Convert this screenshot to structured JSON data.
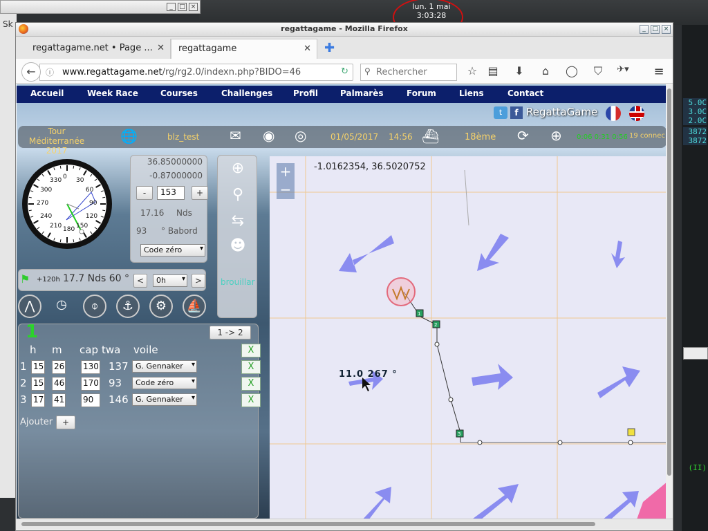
{
  "clock": {
    "line1": "lun.  1 mai",
    "line2": "3:03:28"
  },
  "window_title": "regattagame - Mozilla Firefox",
  "tabs": [
    {
      "label": "regattagame.net • Page ..."
    },
    {
      "label": "regattagame"
    }
  ],
  "nav": {
    "url_domain": "www.regattagame.net",
    "url_path": "/rg/rg2.0/indexn.php?BIDO=46",
    "search_placeholder": "Rechercher"
  },
  "menu": [
    "Accueil",
    "Week Race",
    "Courses",
    "Challenges",
    "Profil",
    "Palmarès",
    "Forum",
    "Liens",
    "Contact"
  ],
  "brand": {
    "name": "RegattaGame"
  },
  "infobar": {
    "race_line1": "Tour Méditerranée",
    "race_line2": "2017",
    "user": "blz_test",
    "date": "01/05/2017",
    "time": "14:56",
    "rank": "18ème",
    "timer": "0:06 0:31 0:56",
    "connected": "19 connec"
  },
  "compass": {
    "labels": [
      "0",
      "30",
      "60",
      "90",
      "120",
      "150",
      "180",
      "210",
      "240",
      "270",
      "300",
      "330"
    ],
    "heading": 153
  },
  "coords": {
    "lat": "36.85000000",
    "lon": "-0.87000000",
    "heading": "153",
    "speed": "17.16",
    "speed_unit": "Nds",
    "twa": "93",
    "twa_unit": "° Babord",
    "sail": "Code zéro"
  },
  "wind": {
    "horizon": "+120h",
    "readout": "17.7 Nds 60 °",
    "offset": "0h",
    "brouillard": "brouillar"
  },
  "waypoints": {
    "number": "1",
    "range_button": "1 -> 2",
    "headers": [
      "h",
      "m",
      "cap",
      "twa",
      "voile"
    ],
    "rows": [
      {
        "idx": "1",
        "h": "15",
        "m": "26",
        "cap": "130",
        "twa": "137",
        "voile": "G. Gennaker"
      },
      {
        "idx": "2",
        "h": "15",
        "m": "46",
        "cap": "170",
        "twa": "93",
        "voile": "Code zéro"
      },
      {
        "idx": "3",
        "h": "17",
        "m": "41",
        "cap": "90",
        "twa": "146",
        "voile": "G. Gennaker"
      }
    ],
    "add_label": "Ajouter",
    "delete_label": "X"
  },
  "map": {
    "coord_readout": "-1.0162354, 36.5020752",
    "wind_label": "11.0   267 °",
    "waypoint_labels": [
      "1",
      "2",
      "3"
    ],
    "colors": {
      "arrow": "#8a8cf0",
      "route": "#222222",
      "grid": "#f0b060",
      "land": "#f06aa8",
      "mark": "#f0e040"
    }
  },
  "right_strip": [
    "5.0C",
    "3.0C",
    "2.0C",
    "3872",
    "3872",
    "(II)"
  ],
  "bg_window_text": "Sk"
}
